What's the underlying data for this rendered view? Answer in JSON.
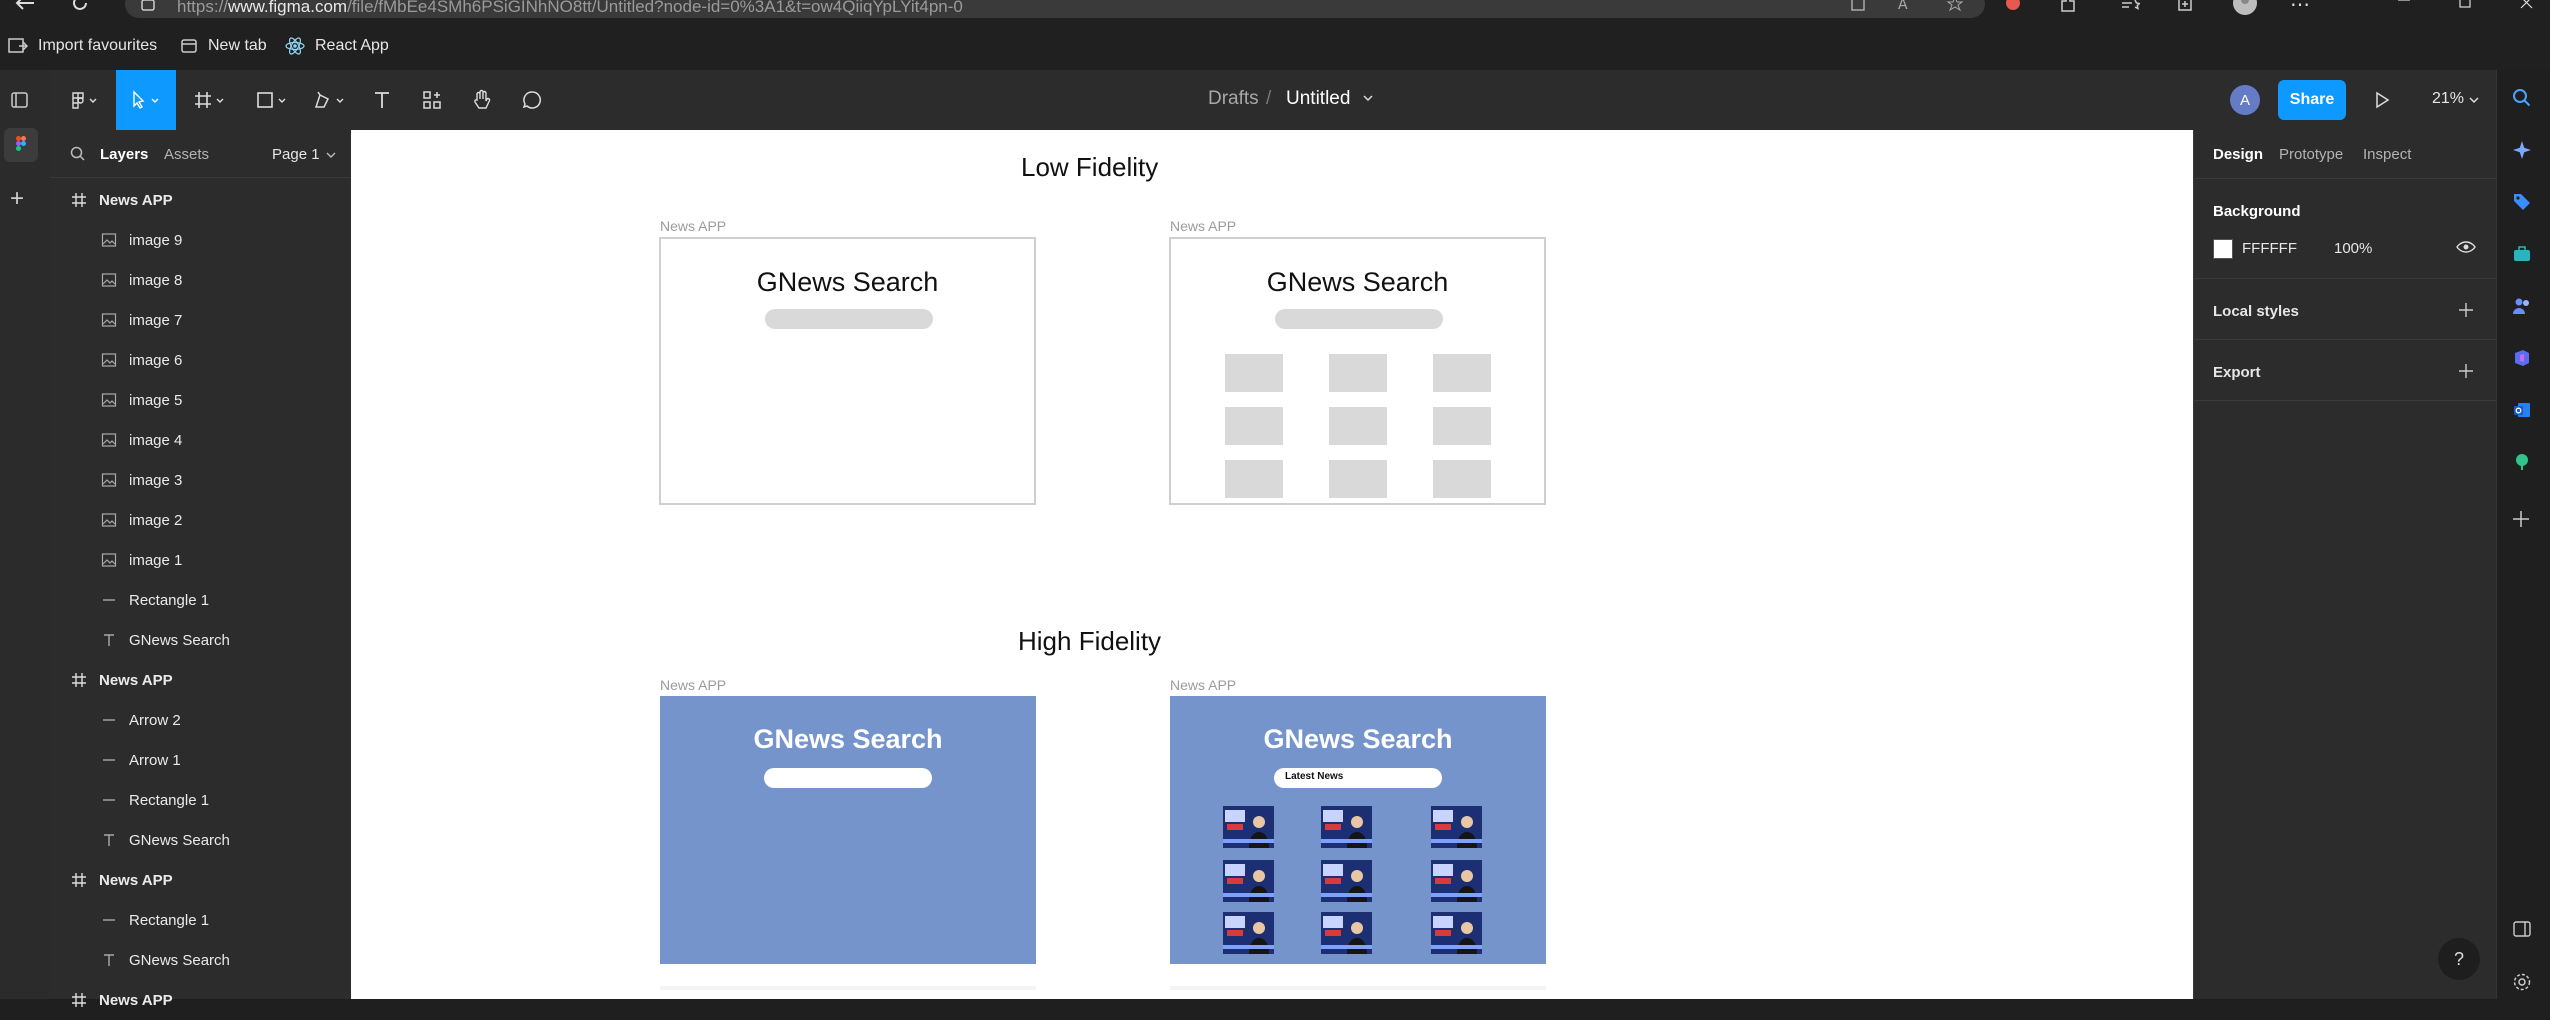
{
  "browser": {
    "url_prefix": "https://",
    "url_domain": "www.figma.com",
    "url_rest": "/file/fMbEe4SMh6PSiGINhNO8tt/Untitled?node-id=0%3A1&t=ow4QiiqYpLYit4pn-0",
    "bookmarks": [
      "Import favourites",
      "New tab",
      "React App"
    ]
  },
  "toolbar": {
    "breadcrumb_parent": "Drafts",
    "breadcrumb_sep": "/",
    "file_name": "Untitled",
    "avatar_initial": "A",
    "share_label": "Share",
    "zoom": "21%"
  },
  "layers_panel": {
    "tab_layers": "Layers",
    "tab_assets": "Assets",
    "page": "Page 1",
    "items": [
      {
        "type": "frame",
        "name": "News APP"
      },
      {
        "type": "image",
        "name": "image 9"
      },
      {
        "type": "image",
        "name": "image 8"
      },
      {
        "type": "image",
        "name": "image 7"
      },
      {
        "type": "image",
        "name": "image 6"
      },
      {
        "type": "image",
        "name": "image 5"
      },
      {
        "type": "image",
        "name": "image 4"
      },
      {
        "type": "image",
        "name": "image 3"
      },
      {
        "type": "image",
        "name": "image 2"
      },
      {
        "type": "image",
        "name": "image 1"
      },
      {
        "type": "line",
        "name": "Rectangle 1"
      },
      {
        "type": "text",
        "name": "GNews Search"
      },
      {
        "type": "frame",
        "name": "News APP"
      },
      {
        "type": "line",
        "name": "Arrow 2"
      },
      {
        "type": "line",
        "name": "Arrow 1"
      },
      {
        "type": "line",
        "name": "Rectangle 1"
      },
      {
        "type": "text",
        "name": "GNews Search"
      },
      {
        "type": "frame",
        "name": "News APP"
      },
      {
        "type": "line",
        "name": "Rectangle 1"
      },
      {
        "type": "text",
        "name": "GNews Search"
      },
      {
        "type": "frame",
        "name": "News APP"
      }
    ]
  },
  "canvas": {
    "low_fidelity_title": "Low Fidelity",
    "high_fidelity_title": "High Fidelity",
    "frame_label": "News APP",
    "app_title": "GNews Search",
    "latest_news": "Latest News",
    "hifi_color": "#7594cc"
  },
  "design_panel": {
    "tabs": [
      "Design",
      "Prototype",
      "Inspect"
    ],
    "background_label": "Background",
    "bg_hex": "FFFFFF",
    "bg_opacity": "100%",
    "local_styles": "Local styles",
    "export": "Export",
    "help": "?"
  },
  "colors": {
    "accent": "#0d99ff",
    "share": "#0d99ff"
  }
}
